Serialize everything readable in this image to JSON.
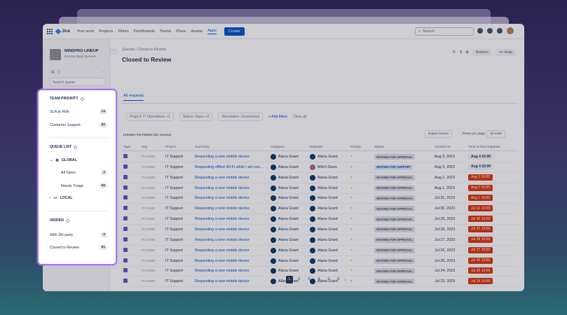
{
  "topnav": {
    "logo": "Jira",
    "items": [
      "Your work",
      "Projects",
      "Filters",
      "Dashboards",
      "Teams",
      "Plans",
      "Assets",
      "Apps"
    ],
    "create": "Create",
    "search_placeholder": "Search"
  },
  "sidebar": {
    "project_name": "MINDPRO LINEUP",
    "project_sub": "Service Desk Queues",
    "search_placeholder": "Search queue"
  },
  "header": {
    "breadcrumb": "Queues / Closed to Review",
    "title": "Closed to Review",
    "actions_label": "Actions",
    "help_label": "••• Help"
  },
  "tabs": [
    "All requests"
  ],
  "filters": [
    "Project: IT Operations +1",
    "Status: Open +3",
    "Resolution: Unresolved"
  ],
  "add_filters": "+ Add filters",
  "clear_all": "Clear all",
  "issues_filtered": "ISSUES FILTERED (61 issues)",
  "export": "Export issues",
  "rows_per_page_label": "Rows per page",
  "rows_per_page": "15 rows",
  "columns": [
    "Type",
    "Key",
    "Project",
    "Summary",
    "Assignee",
    "Reporter",
    "Priority",
    "Status",
    "Created At",
    "Time to first response"
  ],
  "rows": [
    {
      "key": "ITS-0000",
      "project": "IT Support",
      "summary": "Requesting a new mobile device",
      "assignee": "Alana Grant",
      "reporter": "Alana Grant",
      "priority": "=",
      "status": "WAITING FOR APPROVAL",
      "created": "Aug 3, 2023",
      "ttr": "Aug 4 10:00",
      "ttr_ok": true
    },
    {
      "key": "ITS-0000",
      "project": "IT Support",
      "summary": "Requesting offline Wi-Fi while I am con...",
      "assignee": "Alana Grant",
      "reporter": "Mitch Davis",
      "priority": "=",
      "status": "WAITING FOR SUPPORT",
      "created": "Aug 3, 2023",
      "ttr": "Aug 4 10:00",
      "ttr_ok": true
    },
    {
      "key": "ITS-0000",
      "project": "IT Support",
      "summary": "Requesting a new mobile device",
      "assignee": "Alana Grant",
      "reporter": "Alana Grant",
      "priority": "=",
      "status": "WAITING FOR APPROVAL",
      "created": "Aug 2, 2023",
      "ttr": "Aug 3 10:00",
      "ttr_ok": false
    },
    {
      "key": "ITS-0000",
      "project": "IT Support",
      "summary": "Requesting a new mobile device",
      "assignee": "Alana Grant",
      "reporter": "Alana Grant",
      "priority": "=",
      "status": "WAITING FOR APPROVAL",
      "created": "Aug 1, 2023",
      "ttr": "Aug 2 10:00",
      "ttr_ok": false
    },
    {
      "key": "ITS-0000",
      "project": "IT Support",
      "summary": "Requesting a new mobile device",
      "assignee": "Alana Grant",
      "reporter": "Alana Grant",
      "priority": "=",
      "status": "WAITING FOR APPROVAL",
      "created": "Jul 31, 2023",
      "ttr": "Aug 1 10:00",
      "ttr_ok": false
    },
    {
      "key": "ITS-0000",
      "project": "IT Support",
      "summary": "Requesting a new mobile device",
      "assignee": "Alana Grant",
      "reporter": "Alana Grant",
      "priority": "=",
      "status": "WAITING FOR APPROVAL",
      "created": "Jul 30, 2023",
      "ttr": "Jul 31 10:00",
      "ttr_ok": false
    },
    {
      "key": "ITS-0000",
      "project": "IT Support",
      "summary": "Requesting a new mobile device",
      "assignee": "Alana Grant",
      "reporter": "Alana Grant",
      "priority": "=",
      "status": "WAITING FOR APPROVAL",
      "created": "Jul 29, 2023",
      "ttr": "Jul 30 10:00",
      "ttr_ok": false
    },
    {
      "key": "ITS-0000",
      "project": "IT Support",
      "summary": "Requesting a new mobile device",
      "assignee": "Alana Grant",
      "reporter": "Alana Grant",
      "priority": "=",
      "status": "WAITING FOR APPROVAL",
      "created": "Jul 28, 2023",
      "ttr": "Jul 31 10:00",
      "ttr_ok": false
    },
    {
      "key": "ITS-0000",
      "project": "IT Support",
      "summary": "Requesting a new mobile device",
      "assignee": "Alana Grant",
      "reporter": "Alana Grant",
      "priority": "=",
      "status": "WAITING FOR APPROVAL",
      "created": "Jul 27, 2023",
      "ttr": "Jul 28 10:00",
      "ttr_ok": false
    },
    {
      "key": "ITS-0000",
      "project": "IT Support",
      "summary": "Requesting a new mobile device",
      "assignee": "Alana Grant",
      "reporter": "Alana Grant",
      "priority": "=",
      "status": "WAITING FOR APPROVAL",
      "created": "Jul 26, 2023",
      "ttr": "Jul 27 10:00",
      "ttr_ok": false
    },
    {
      "key": "ITS-0000",
      "project": "IT Support",
      "summary": "Requesting a new mobile device",
      "assignee": "Alana Grant",
      "reporter": "Alana Grant",
      "priority": "=",
      "status": "WAITING FOR APPROVAL",
      "created": "Jul 25, 2023",
      "ttr": "Jul 26 10:00",
      "ttr_ok": false
    },
    {
      "key": "ITS-0000",
      "project": "IT Support",
      "summary": "Requesting a new mobile device",
      "assignee": "Alana Grant",
      "reporter": "Alana Grant",
      "priority": "=",
      "status": "WAITING FOR APPROVAL",
      "created": "Jul 24, 2023",
      "ttr": "Jul 25 10:00",
      "ttr_ok": false
    },
    {
      "key": "ITS-0000",
      "project": "IT Support",
      "summary": "Requesting a new mobile device",
      "assignee": "Alana Grant",
      "reporter": "Alana Grant",
      "priority": "=",
      "status": "WAITING FOR APPROVAL",
      "created": "Jul 23, 2023",
      "ttr": "Jul 24 10:00",
      "ttr_ok": false
    }
  ],
  "pages": [
    "1",
    "2",
    "3",
    "4",
    "5",
    "6"
  ],
  "panel": {
    "team_priority": "TEAM PRIORITY",
    "sla": {
      "label": "SLA at Risk",
      "count": "14"
    },
    "support": {
      "label": "Customer Support",
      "count": "82"
    },
    "queue_list": "QUEUE LIST",
    "global": "GLOBAL",
    "all_open": {
      "label": "All Open",
      "count": "2"
    },
    "needs_triage": {
      "label": "Needs Triage",
      "count": "96"
    },
    "local": "LOCAL",
    "hidden": "HIDDEN",
    "third_party": {
      "label": "With 3th party",
      "count": "6"
    },
    "closed_review": {
      "label": "Closed to Review",
      "count": "81"
    }
  },
  "colors": {
    "accent": "#0052cc",
    "highlight": "#a675f0",
    "danger": "#de350b"
  }
}
